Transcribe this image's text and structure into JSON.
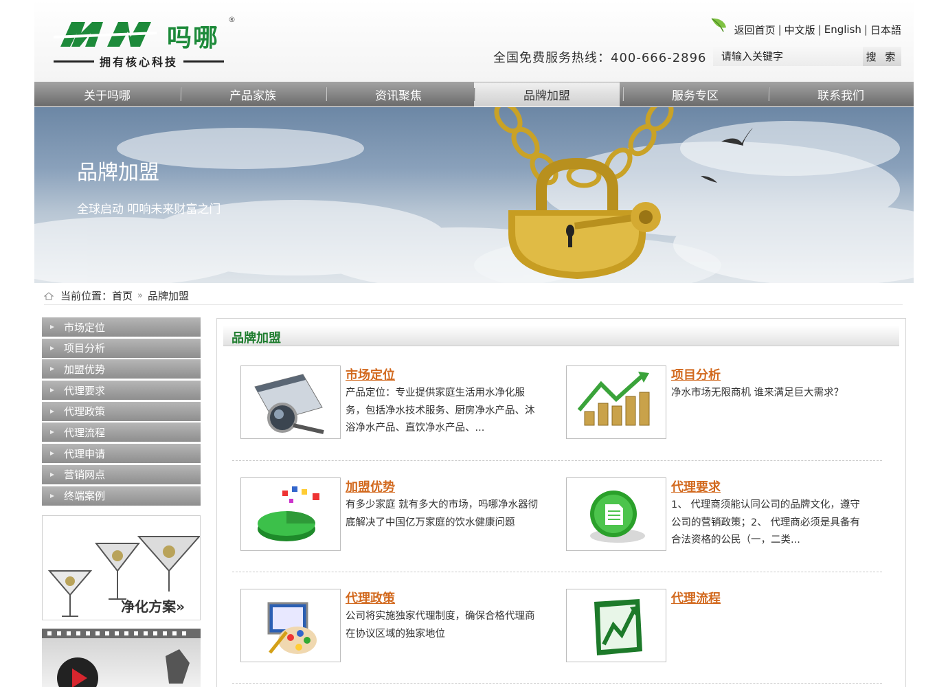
{
  "header": {
    "logo_cn": "吗哪",
    "logo_reg": "®",
    "slogan": "拥有核心科技",
    "toplinks": [
      "返回首页",
      "中文版",
      "English",
      "日本語"
    ],
    "hotline": "全国免费服务热线：400-666-2896",
    "search_placeholder": "请输入关键字",
    "search_button": "搜 索"
  },
  "nav": {
    "items": [
      "关于吗哪",
      "产品家族",
      "资讯聚焦",
      "品牌加盟",
      "服务专区",
      "联系我们"
    ],
    "active_index": 3
  },
  "banner": {
    "title": "品牌加盟",
    "subtitle": "全球启动  叩响未来财富之门"
  },
  "breadcrumb": {
    "label": "当前位置：",
    "home": "首页",
    "separator": "»",
    "current": "品牌加盟"
  },
  "sidebar": {
    "items": [
      "市场定位",
      "项目分析",
      "加盟优势",
      "代理要求",
      "代理政策",
      "代理流程",
      "代理申请",
      "营销网点",
      "终端案例"
    ],
    "promo1_label": "净化方案»"
  },
  "main": {
    "title": "品牌加盟",
    "cards": [
      {
        "title": "市场定位",
        "desc": "产品定位：专业提供家庭生活用水净化服务，包括净水技术服务、厨房净水产品、沐浴净水产品、直饮净水产品、...",
        "icon": "magnifier-icon"
      },
      {
        "title": "项目分析",
        "desc": "净水市场无限商机 谁来满足巨大需求？",
        "icon": "coins-growth-icon"
      },
      {
        "title": "加盟优势",
        "desc": "有多少家庭 就有多大的市场，吗哪净水器彻底解决了中国亿万家庭的饮水健康问题",
        "icon": "pie-chart-icon"
      },
      {
        "title": "代理要求",
        "desc": "1、 代理商须能认同公司的品牌文化，遵守公司的营销政策；2、 代理商必须是具备有合法资格的公民（一，二类...",
        "icon": "document-icon"
      },
      {
        "title": "代理政策",
        "desc": "公司将实施独家代理制度，确保合格代理商在协议区域的独家地位",
        "icon": "paint-palette-icon"
      },
      {
        "title": "代理流程",
        "desc": "",
        "icon": "excel-chart-icon"
      }
    ]
  },
  "colors": {
    "brand_green": "#1d8a3a",
    "card_title": "#d2691e",
    "nav_gray": "#7a7a7a"
  }
}
